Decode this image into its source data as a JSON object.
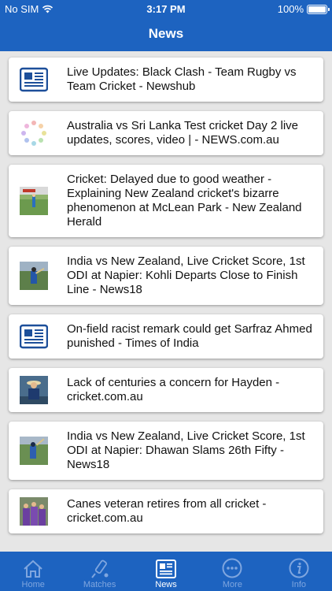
{
  "status": {
    "carrier": "No SIM",
    "time": "3:17 PM",
    "battery": "100%"
  },
  "header": {
    "title": "News"
  },
  "news": [
    {
      "thumb": "newspaper-icon",
      "headline": "Live Updates: Black Clash - Team Rugby vs Team Cricket - Newshub"
    },
    {
      "thumb": "loading-icon",
      "headline": "Australia vs Sri Lanka Test cricket Day 2 live updates, scores, video | - NEWS.com.au"
    },
    {
      "thumb": "photo-thumb",
      "headline": "Cricket: Delayed due to good weather - Explaining New Zealand cricket's bizarre phenomenon at McLean Park - New Zealand Herald"
    },
    {
      "thumb": "photo-thumb",
      "headline": "India vs New Zealand, Live Cricket Score, 1st ODI at Napier: Kohli Departs Close to Finish Line - News18"
    },
    {
      "thumb": "newspaper-icon",
      "headline": "On-field racist remark could get Sarfraz Ahmed punished - Times of India"
    },
    {
      "thumb": "photo-thumb",
      "headline": "Lack of centuries a concern for Hayden - cricket.com.au"
    },
    {
      "thumb": "photo-thumb",
      "headline": "India vs New Zealand, Live Cricket Score, 1st ODI at Napier: Dhawan Slams 26th Fifty - News18"
    },
    {
      "thumb": "photo-thumb",
      "headline": "Canes veteran retires from all cricket - cricket.com.au"
    }
  ],
  "tabs": [
    {
      "label": "Home",
      "icon": "home-icon"
    },
    {
      "label": "Matches",
      "icon": "bat-icon"
    },
    {
      "label": "News",
      "icon": "newspaper-icon",
      "active": true
    },
    {
      "label": "More",
      "icon": "more-icon"
    },
    {
      "label": "Info",
      "icon": "info-icon"
    }
  ],
  "colors": {
    "brand": "#1d63c0",
    "tab_inactive": "#7fa6df",
    "background": "#e6e6e6"
  }
}
